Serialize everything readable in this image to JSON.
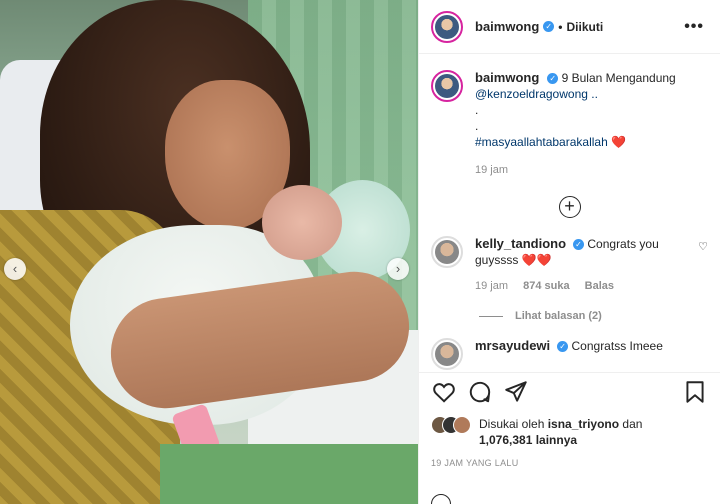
{
  "post": {
    "username": "baimwong",
    "follow_status": "Diikuti",
    "more_icon": "•••"
  },
  "caption": {
    "username": "baimwong",
    "text": "9 Bulan Mengandung",
    "mention": "@kenzoeldragowong ..",
    "dot1": ".",
    "dot2": ".",
    "hashtag": "#masyaallahtabarakallah",
    "heart": "❤️",
    "time": "19 jam"
  },
  "load_more_icon": "+",
  "comments": [
    {
      "username": "kelly_tandiono",
      "text": "Congrats you guyssss ❤️❤️",
      "time": "19 jam",
      "likes": "874 suka",
      "reply": "Balas",
      "view_replies": "Lihat balasan (2)"
    },
    {
      "username": "mrsayudewi",
      "text": "Congratss Imeee"
    }
  ],
  "likes": {
    "prefix": "Disukai oleh",
    "user": "isna_triyono",
    "and": "dan",
    "count": "1,076,381 lainnya"
  },
  "timestamp": "19 JAM YANG LALU",
  "nav": {
    "prev": "‹",
    "next": "›"
  },
  "colors": {
    "verified": "#3897f0",
    "story_ring": "#d6249f",
    "text": "#262626",
    "muted": "#8e8e8e"
  }
}
